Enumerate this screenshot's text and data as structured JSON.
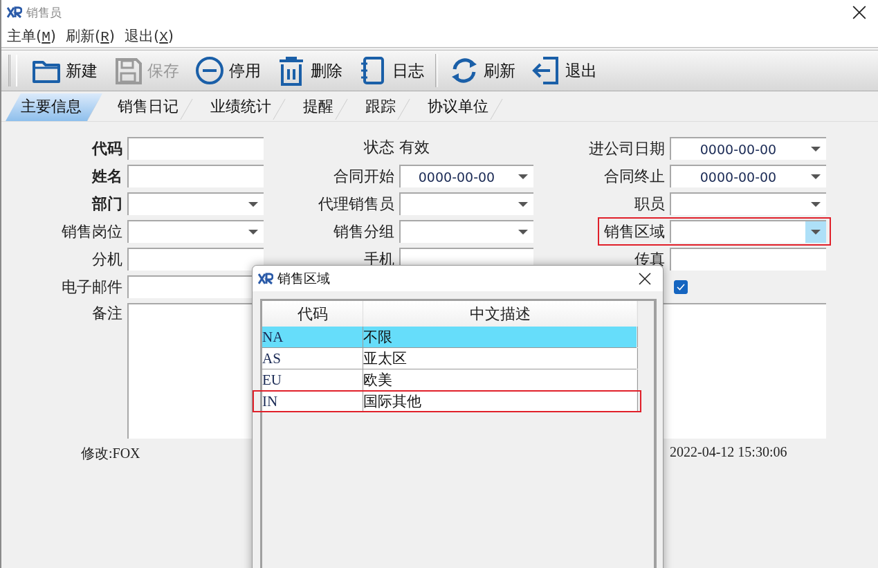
{
  "window": {
    "title": "销售员"
  },
  "menu": [
    {
      "before": "主单(",
      "key": "M",
      "after": ")"
    },
    {
      "before": "刷新(",
      "key": "R",
      "after": ")"
    },
    {
      "before": "退出(",
      "key": "X",
      "after": ")"
    }
  ],
  "toolbar": [
    {
      "label": "新建",
      "disabled": false
    },
    {
      "label": "保存",
      "disabled": true
    },
    {
      "label": "停用",
      "disabled": false
    },
    {
      "label": "删除",
      "disabled": false
    },
    {
      "label": "日志",
      "disabled": false
    },
    {
      "label": "刷新",
      "disabled": false,
      "separator_before": true
    },
    {
      "label": "退出",
      "disabled": false
    }
  ],
  "tabs": [
    {
      "label": "主要信息",
      "selected": true
    },
    {
      "label": "销售日记",
      "selected": false
    },
    {
      "label": "业绩统计",
      "selected": false
    },
    {
      "label": "提醒",
      "selected": false
    },
    {
      "label": "跟踪",
      "selected": false
    },
    {
      "label": "协议单位",
      "selected": false
    }
  ],
  "form": {
    "rows": [
      {
        "left": {
          "kind": "text",
          "label": "代码",
          "bold": true
        },
        "middle": {
          "kind": "static",
          "label": "状态",
          "value": "有效",
          "bold": false
        },
        "right": {
          "kind": "date",
          "label": "进公司日期",
          "value": "0000-00-00",
          "bold": false,
          "hot": false
        }
      },
      {
        "left": {
          "kind": "text",
          "label": "姓名",
          "bold": true
        },
        "middle": {
          "kind": "date",
          "label": "合同开始",
          "value": "0000-00-00",
          "bold": false,
          "hot": false
        },
        "right": {
          "kind": "date",
          "label": "合同终止",
          "value": "0000-00-00",
          "bold": false,
          "hot": false
        }
      },
      {
        "left": {
          "kind": "combo",
          "label": "部门",
          "bold": true,
          "hot": false
        },
        "middle": {
          "kind": "combo",
          "label": "代理销售员",
          "bold": false,
          "hot": false
        },
        "right": {
          "kind": "combo",
          "label": "职员",
          "bold": false,
          "hot": false
        }
      },
      {
        "left": {
          "kind": "combo",
          "label": "销售岗位",
          "bold": false,
          "hot": false
        },
        "middle": {
          "kind": "combo",
          "label": "销售分组",
          "bold": false,
          "hot": false
        },
        "right": {
          "kind": "combo",
          "label": "销售区域",
          "bold": false,
          "highlighted": true,
          "hot": true
        }
      },
      {
        "left": {
          "kind": "text",
          "label": "分机",
          "bold": false
        },
        "middle": {
          "kind": "text",
          "label": "手机",
          "bold": false
        },
        "right": {
          "kind": "text",
          "label": "传真",
          "bold": false
        }
      },
      {
        "left": {
          "kind": "text",
          "label": "电子邮件",
          "bold": false
        },
        "right": {
          "kind": "checkbox",
          "checked": true
        }
      },
      {
        "left": {
          "kind": "memo",
          "label": "备注",
          "bold": false
        }
      }
    ],
    "footer": {
      "modified_by": "修改:FOX",
      "modified_at": "2022-04-12 15:30:06"
    }
  },
  "dialog": {
    "title": "销售区域",
    "columns": [
      "代码",
      "中文描述"
    ],
    "rows": [
      {
        "code": "NA",
        "description": "不限",
        "selected": true
      },
      {
        "code": "AS",
        "description": "亚太区",
        "selected": false
      },
      {
        "code": "EU",
        "description": "欧美",
        "selected": false
      },
      {
        "code": "IN",
        "description": "国际其他",
        "selected": false,
        "highlighted": true
      }
    ]
  }
}
